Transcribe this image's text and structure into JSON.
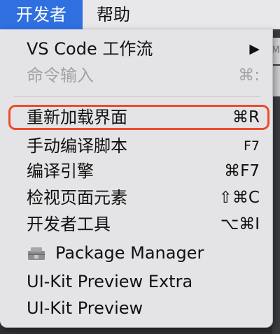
{
  "menubar": {
    "active_item": "开发者",
    "help_item": "帮助"
  },
  "menu": {
    "items": [
      {
        "label": "VS Code 工作流",
        "shortcut": "▶",
        "disabled": false
      },
      {
        "label": "命令输入",
        "shortcut": "⌘:",
        "disabled": true
      },
      {
        "label": "重新加载界面",
        "shortcut": "⌘R",
        "disabled": false,
        "highlighted": true
      },
      {
        "label": "手动编译脚本",
        "shortcut": "F7",
        "disabled": false
      },
      {
        "label": "编译引擎",
        "shortcut": "⌘F7",
        "disabled": false
      },
      {
        "label": "检视页面元素",
        "shortcut": "⇧⌘C",
        "disabled": false
      },
      {
        "label": "开发者工具",
        "shortcut": "⌥⌘I",
        "disabled": false
      },
      {
        "label": "Package Manager",
        "shortcut": "",
        "disabled": false,
        "icon": "package-icon"
      },
      {
        "label": "UI-Kit Preview Extra",
        "shortcut": "",
        "disabled": false
      },
      {
        "label": "UI-Kit Preview",
        "shortcut": "",
        "disabled": false
      }
    ]
  },
  "background": {
    "fragment_text": "Ma"
  },
  "colors": {
    "active_menu_blue": "#2f6fe0",
    "highlight_red": "#ee4b2b",
    "menu_background": "#e4e4e6",
    "disabled_text": "#a3a3a7"
  }
}
